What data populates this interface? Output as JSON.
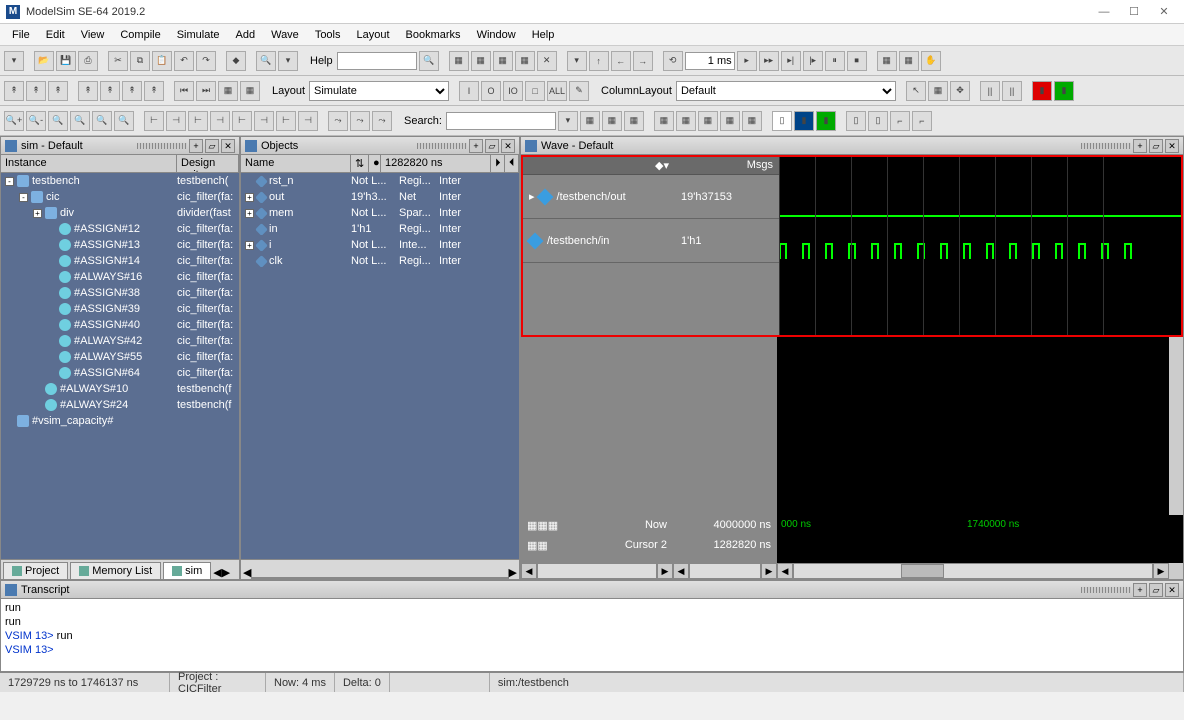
{
  "title": "ModelSim SE-64 2019.2",
  "menu": [
    "File",
    "Edit",
    "View",
    "Compile",
    "Simulate",
    "Add",
    "Wave",
    "Tools",
    "Layout",
    "Bookmarks",
    "Window",
    "Help"
  ],
  "toolbar1": {
    "help_label": "Help",
    "time_val": "1 ms"
  },
  "toolbar2": {
    "layout_label": "Layout",
    "layout_val": "Simulate",
    "collayout_label": "ColumnLayout",
    "collayout_val": "Default"
  },
  "toolbar3": {
    "search_label": "Search:"
  },
  "sim_pane": {
    "title": "sim - Default",
    "cols": [
      "Instance",
      "Design unit"
    ],
    "rows": [
      {
        "ind": 0,
        "exp": "-",
        "ico": "box",
        "name": "testbench",
        "du": "testbench("
      },
      {
        "ind": 1,
        "exp": "-",
        "ico": "box",
        "name": "cic",
        "du": "cic_filter(fa:"
      },
      {
        "ind": 2,
        "exp": "+",
        "ico": "box",
        "name": "div",
        "du": "divider(fast"
      },
      {
        "ind": 3,
        "exp": "",
        "ico": "ball",
        "name": "#ASSIGN#12",
        "du": "cic_filter(fa:"
      },
      {
        "ind": 3,
        "exp": "",
        "ico": "ball",
        "name": "#ASSIGN#13",
        "du": "cic_filter(fa:"
      },
      {
        "ind": 3,
        "exp": "",
        "ico": "ball",
        "name": "#ASSIGN#14",
        "du": "cic_filter(fa:"
      },
      {
        "ind": 3,
        "exp": "",
        "ico": "ball",
        "name": "#ALWAYS#16",
        "du": "cic_filter(fa:"
      },
      {
        "ind": 3,
        "exp": "",
        "ico": "ball",
        "name": "#ASSIGN#38",
        "du": "cic_filter(fa:"
      },
      {
        "ind": 3,
        "exp": "",
        "ico": "ball",
        "name": "#ASSIGN#39",
        "du": "cic_filter(fa:"
      },
      {
        "ind": 3,
        "exp": "",
        "ico": "ball",
        "name": "#ASSIGN#40",
        "du": "cic_filter(fa:"
      },
      {
        "ind": 3,
        "exp": "",
        "ico": "ball",
        "name": "#ALWAYS#42",
        "du": "cic_filter(fa:"
      },
      {
        "ind": 3,
        "exp": "",
        "ico": "ball",
        "name": "#ALWAYS#55",
        "du": "cic_filter(fa:"
      },
      {
        "ind": 3,
        "exp": "",
        "ico": "ball",
        "name": "#ASSIGN#64",
        "du": "cic_filter(fa:"
      },
      {
        "ind": 2,
        "exp": "",
        "ico": "ball",
        "name": "#ALWAYS#10",
        "du": "testbench(f"
      },
      {
        "ind": 2,
        "exp": "",
        "ico": "ball",
        "name": "#ALWAYS#24",
        "du": "testbench(f"
      },
      {
        "ind": 0,
        "exp": "",
        "ico": "cap",
        "name": "#vsim_capacity#",
        "du": ""
      }
    ],
    "tabs": [
      "Project",
      "Memory List",
      "sim"
    ]
  },
  "obj_pane": {
    "title": "Objects",
    "cols": [
      "Name",
      "",
      "1282820 ns",
      ""
    ],
    "rows": [
      {
        "exp": "",
        "name": "rst_n",
        "v": "Not L...",
        "k": "Regi...",
        "m": "Inter"
      },
      {
        "exp": "+",
        "name": "out",
        "v": "19'h3...",
        "k": "Net",
        "m": "Inter"
      },
      {
        "exp": "+",
        "name": "mem",
        "v": "Not L...",
        "k": "Spar...",
        "m": "Inter"
      },
      {
        "exp": "",
        "name": "in",
        "v": "1'h1",
        "k": "Regi...",
        "m": "Inter"
      },
      {
        "exp": "+",
        "name": "i",
        "v": "Not L...",
        "k": "Inte...",
        "m": "Inter"
      },
      {
        "exp": "",
        "name": "clk",
        "v": "Not L...",
        "k": "Regi...",
        "m": "Inter"
      }
    ]
  },
  "wave_pane": {
    "title": "Wave - Default",
    "msgs_hdr": "Msgs",
    "signals": [
      {
        "name": "/testbench/out",
        "val": "19'h37153"
      },
      {
        "name": "/testbench/in",
        "val": "1'h1"
      }
    ],
    "now_label": "Now",
    "now_val": "4000000 ns",
    "cursor_label": "Cursor 2",
    "cursor_val": "1282820 ns",
    "ruler_left": "000 ns",
    "ruler_right": "1740000 ns"
  },
  "transcript": {
    "title": "Transcript",
    "lines": [
      "run",
      "run",
      "VSIM 13> run",
      "",
      "VSIM 13>"
    ]
  },
  "status": {
    "range": "1729729 ns to 1746137 ns",
    "project": "Project : CICFilter",
    "now": "Now: 4 ms",
    "delta": "Delta: 0",
    "sim": "sim:/testbench"
  }
}
